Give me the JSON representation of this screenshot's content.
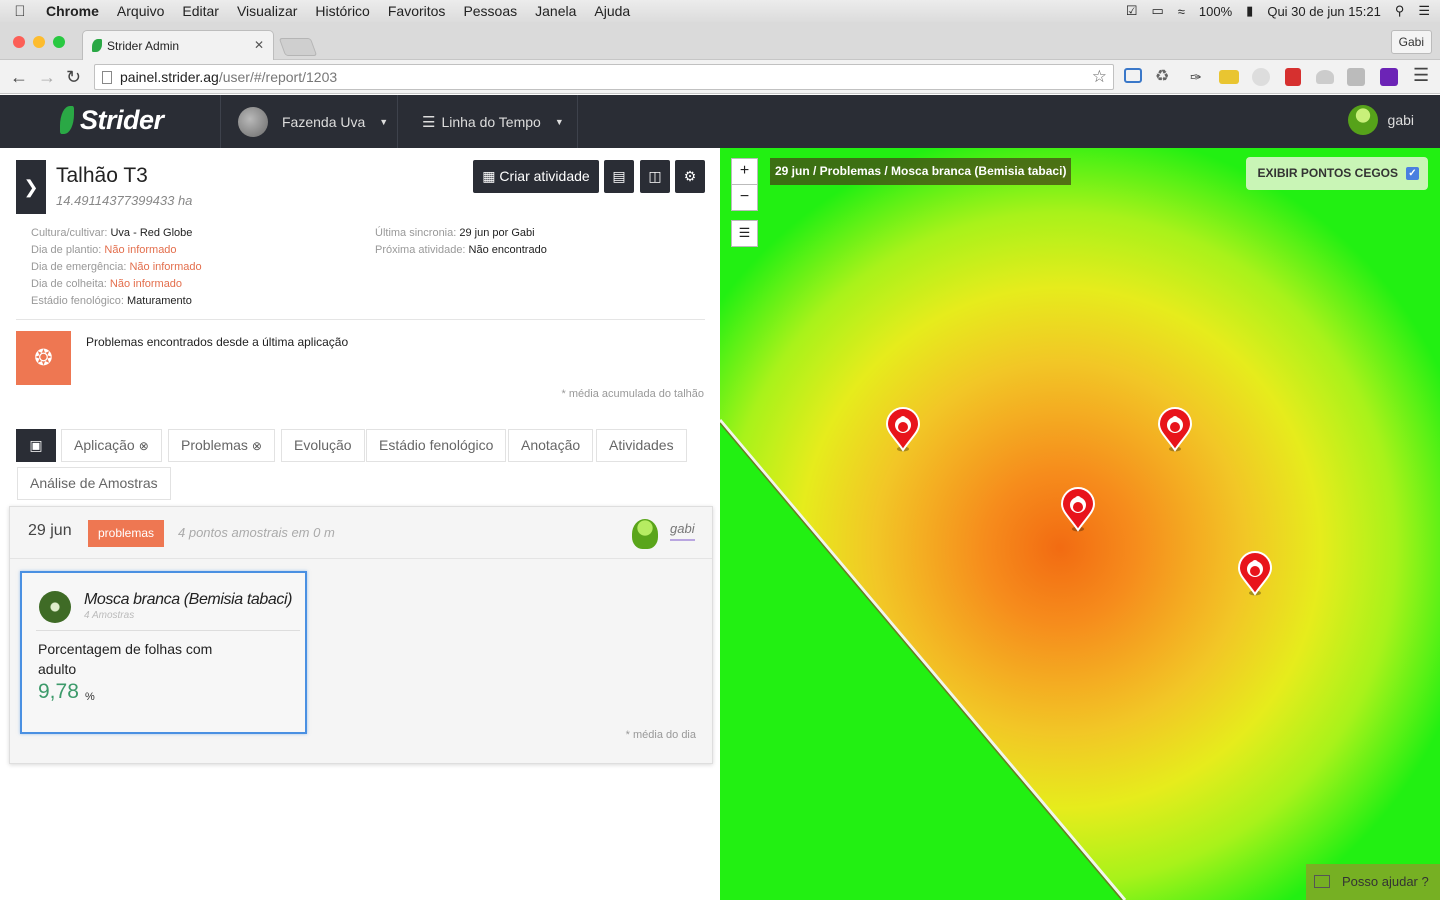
{
  "mac_menu": {
    "app": "Chrome",
    "items": [
      "Arquivo",
      "Editar",
      "Visualizar",
      "Histórico",
      "Favoritos",
      "Pessoas",
      "Janela",
      "Ajuda"
    ],
    "battery": "100%",
    "clock": "Qui 30 de jun  15:21"
  },
  "browser": {
    "tab_title": "Strider Admin",
    "profile": "Gabi",
    "url_host": "painel.strider.ag",
    "url_path": "/user/#/report/1203"
  },
  "app_nav": {
    "brand": "Strider",
    "farm": "Fazenda Uva",
    "timeline": "Linha do Tempo",
    "user": "gabi"
  },
  "field": {
    "title": "Talhão T3",
    "area": "14.49114377399433 ha",
    "create_activity": "Criar atividade",
    "info_left": [
      {
        "label": "Cultura/cultivar: ",
        "value": "Uva - Red Globe",
        "warn": false
      },
      {
        "label": "Dia de plantio: ",
        "value": "Não informado",
        "warn": true
      },
      {
        "label": "Dia de emergência: ",
        "value": "Não informado",
        "warn": true
      },
      {
        "label": "Dia de colheita: ",
        "value": "Não informado",
        "warn": true
      },
      {
        "label": "Estádio fenológico: ",
        "value": "Maturamento",
        "warn": false
      }
    ],
    "info_right": [
      {
        "label": "Última sincronia: ",
        "value": "29 jun por Gabi"
      },
      {
        "label": "Próxima atividade: ",
        "value": "Não encontrado"
      }
    ],
    "alert": "Problemas encontrados desde a última aplicação",
    "alert_note": "* média acumulada do talhão"
  },
  "tabs": [
    "Aplicação",
    "Problemas",
    "Evolução",
    "Estádio fenológico",
    "Anotação",
    "Atividades",
    "Análise de Amostras"
  ],
  "report": {
    "date": "29 jun",
    "badge": "problemas",
    "points": "4 pontos amostrais em 0 m",
    "user": "gabi",
    "day_note": "* média do dia",
    "card": {
      "name": "Mosca branca (Bemisia tabaci)",
      "samples": "4 Amostras",
      "metric": "Porcentagem de folhas com adulto",
      "value": "9,78",
      "unit": "%"
    }
  },
  "map": {
    "zoom_in": "+",
    "zoom_out": "−",
    "title": "29 jun / Problemas / Mosca branca (Bemisia tabaci)",
    "blind_spots": "EXIBIR PONTOS CEGOS",
    "blind_spots_checked": true,
    "help": "Posso ajudar ?",
    "pin_color": "#e8141b"
  }
}
